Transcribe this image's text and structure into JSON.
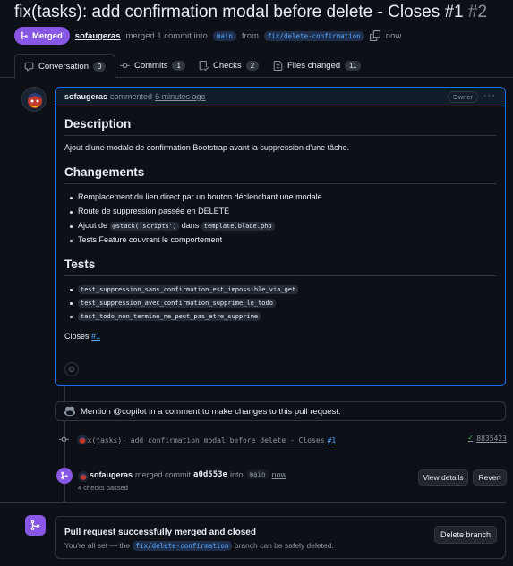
{
  "pr": {
    "title": "fix(tasks): add confirmation modal before delete - Closes #1",
    "number": "#2",
    "state": "Merged",
    "author": "sofaugeras",
    "merge_text": "merged 1 commit into",
    "base_branch": "main",
    "from_text": "from",
    "head_branch": "fix/delete-confirmation",
    "time": "now"
  },
  "tabs": [
    {
      "label": "Conversation",
      "count": "0",
      "icon": "comment-icon"
    },
    {
      "label": "Commits",
      "count": "1",
      "icon": "commit-icon"
    },
    {
      "label": "Checks",
      "count": "2",
      "icon": "checklist-icon"
    },
    {
      "label": "Files changed",
      "count": "11",
      "icon": "file-diff-icon"
    }
  ],
  "comment": {
    "author": "sofaugeras",
    "verb": "commented",
    "time": "6 minutes ago",
    "role": "Owner",
    "description_heading": "Description",
    "description_text": "Ajout d'une modale de confirmation Bootstrap avant la suppression d'une tâche.",
    "changes_heading": "Changements",
    "changes": {
      "item1": "Remplacement du lien direct par un bouton déclenchant une modale",
      "item2": "Route de suppression passée en DELETE",
      "item3_pre": "Ajout de",
      "item3_code1": "@stack('scripts')",
      "item3_mid": "dans",
      "item3_code2": "template.blade.php",
      "item4": "Tests Feature couvrant le comportement"
    },
    "tests_heading": "Tests",
    "tests": [
      "test_suppression_sans_confirmation_est_impossible_via_get",
      "test_suppression_avec_confirmation_supprime_le_todo",
      "test_todo_non_termine_ne_peut_pas_etre_supprime"
    ],
    "closes_text": "Closes",
    "closes_link": "#1"
  },
  "mention_text": "Mention @copilot in a comment to make changes to this pull request.",
  "commit": {
    "message": "fix(tasks): add confirmation modal before delete - Closes",
    "link": "#1",
    "sha": "8835423",
    "status_color": "#3fb950"
  },
  "merge_event": {
    "author": "sofaugeras",
    "text": "merged commit",
    "sha": "a0d553e",
    "into": "into",
    "branch": "main",
    "time": "now",
    "checks": "4 checks passed",
    "view_details": "View details",
    "revert": "Revert"
  },
  "merged_box": {
    "title": "Pull request successfully merged and closed",
    "text_pre": "You're all set — the",
    "branch": "fix/delete-confirmation",
    "text_post": "branch can be safely deleted.",
    "delete_button": "Delete branch"
  },
  "colors": {
    "merged": "#8957e5",
    "link": "#58a6ff",
    "accent_border": "#1f6feb",
    "success": "#3fb950"
  }
}
